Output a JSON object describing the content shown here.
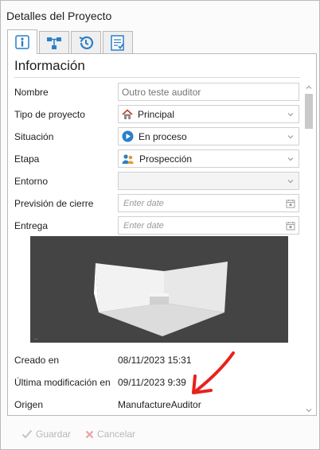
{
  "window": {
    "title": "Detalles del Proyecto"
  },
  "tabs": [
    {
      "name": "info",
      "icon": "info-icon",
      "active": true
    },
    {
      "name": "structure",
      "icon": "hierarchy-icon",
      "active": false
    },
    {
      "name": "history",
      "icon": "history-icon",
      "active": false
    },
    {
      "name": "checklist",
      "icon": "checklist-icon",
      "active": false
    }
  ],
  "section": {
    "title": "Información"
  },
  "form": {
    "nombre_label": "Nombre",
    "nombre_placeholder": "Outro teste auditor",
    "tipo_label": "Tipo de proyecto",
    "tipo_value": "Principal",
    "situacion_label": "Situación",
    "situacion_value": "En proceso",
    "etapa_label": "Etapa",
    "etapa_value": "Prospección",
    "entorno_label": "Entorno",
    "entorno_value": "",
    "prevision_label": "Previsión de cierre",
    "prevision_placeholder": "Enter date",
    "entrega_label": "Entrega",
    "entrega_placeholder": "Enter date"
  },
  "meta": {
    "creado_label": "Creado en",
    "creado_value": "08/11/2023 15:31",
    "modificacion_label": "Última modificación en",
    "modificacion_value": "09/11/2023 9:39",
    "origen_label": "Origen",
    "origen_value": "ManufactureAuditor"
  },
  "footer": {
    "save_label": "Guardar",
    "cancel_label": "Cancelar"
  },
  "colors": {
    "accent_blue": "#2a7fc9",
    "annotation_red": "#e8211b",
    "disabled_text": "#b8b8b8"
  }
}
